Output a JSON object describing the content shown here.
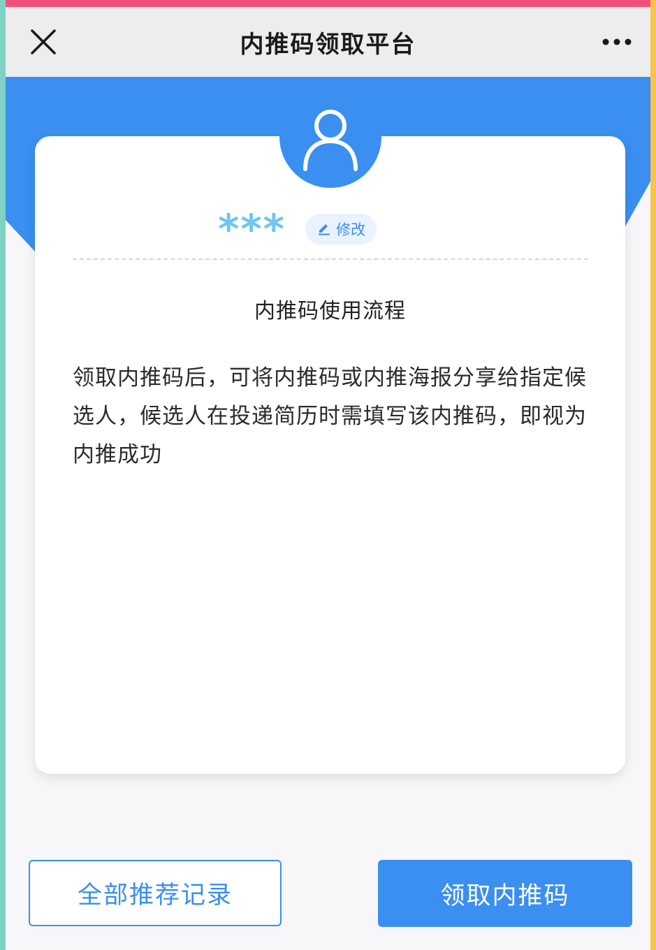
{
  "navbar": {
    "title": "内推码领取平台",
    "close_icon": "close-icon",
    "more_icon": "more-icon"
  },
  "profile": {
    "avatar_icon": "user-icon",
    "masked_name": "***",
    "edit_label": "修改",
    "edit_icon": "pencil-icon"
  },
  "card": {
    "section_title": "内推码使用流程",
    "description": "领取内推码后，可将内推码或内推海报分享给指定候选人，候选人在投递简历时需填写该内推码，即视为内推成功"
  },
  "actions": {
    "records_label": "全部推荐记录",
    "claim_label": "领取内推码"
  },
  "colors": {
    "primary": "#3a8ff0",
    "masked_name": "#6fc6f0"
  }
}
